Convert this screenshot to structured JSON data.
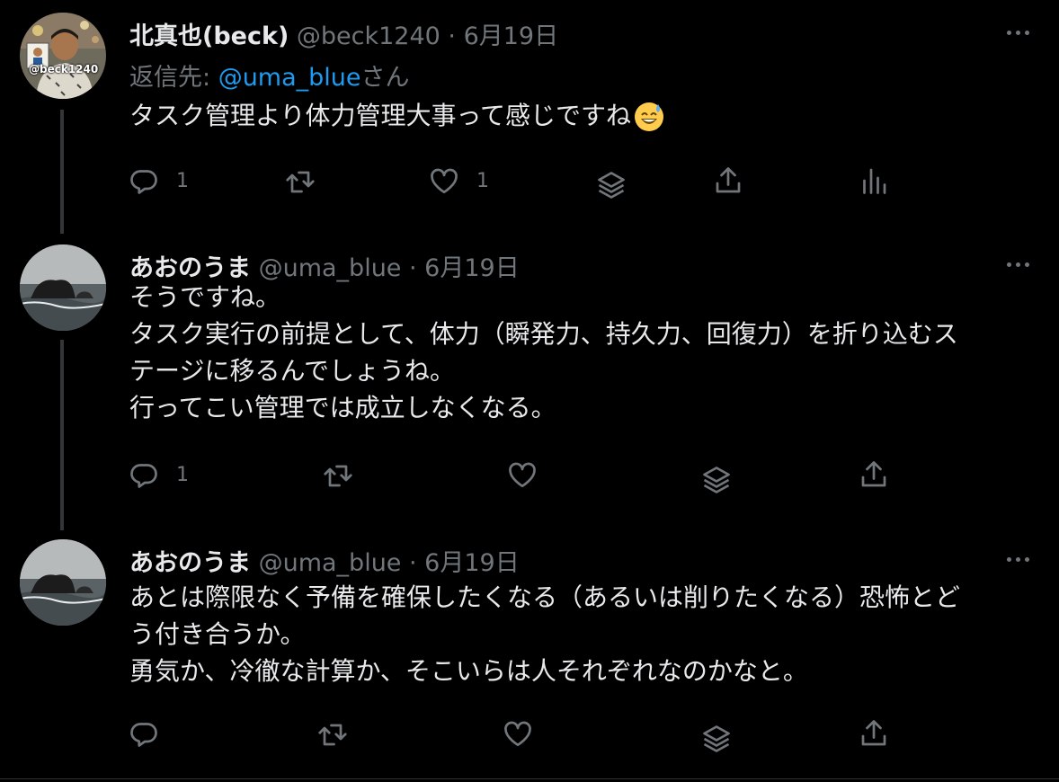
{
  "tweets": [
    {
      "name": "北真也(beck)",
      "meta": "@beck1240 · 6月19日",
      "avatar_caption": "@beck1240",
      "reply_prefix": "返信先: ",
      "reply_handle": "@uma_blue",
      "reply_suffix": "さん",
      "text": "タスク管理より体力管理大事って感じですね",
      "emoji": "sweat-smile-emoji",
      "reply_count": "1",
      "like_count": "1"
    },
    {
      "name": "あおのうま",
      "meta": "@uma_blue · 6月19日",
      "text": "そうですね。\nタスク実行の前提として、体力（瞬発力、持久力、回復力）を折り込むス\nテージに移るんでしょうね。\n行ってこい管理では成立しなくなる。",
      "reply_count": "1"
    },
    {
      "name": "あおのうま",
      "meta": "@uma_blue · 6月19日",
      "text": "あとは際限なく予備を確保したくなる（あるいは削りたくなる）恐怖とど\nう付き合うか。\n勇気か、冷徹な計算か、そこいらは人それぞれなのかなと。"
    }
  ],
  "icons": [
    "reply-icon",
    "retweet-icon",
    "like-icon",
    "layers-icon",
    "share-icon",
    "analytics-icon",
    "more-icon"
  ],
  "colors": {
    "background": "#000000",
    "text": "#e7e9ea",
    "muted": "#71767b",
    "link": "#1d9bf0",
    "thread_line": "#333639"
  }
}
